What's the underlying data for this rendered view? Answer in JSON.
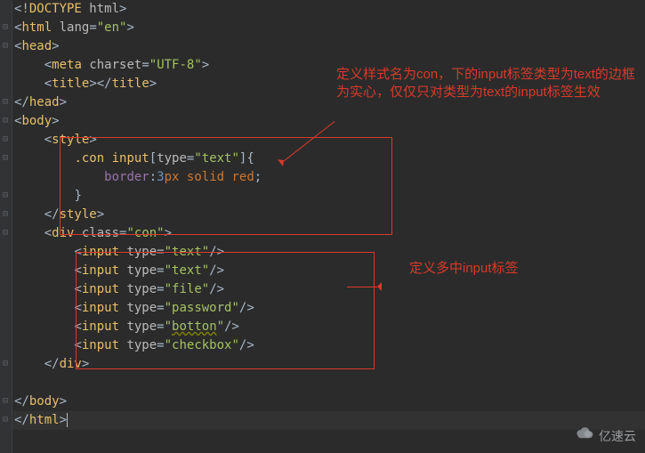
{
  "code": {
    "lines": [
      {
        "segments": [
          {
            "t": "<!",
            "c": "p"
          },
          {
            "t": "DOCTYPE ",
            "c": "tag"
          },
          {
            "t": "html",
            "c": "attr"
          },
          {
            "t": ">",
            "c": "p"
          }
        ]
      },
      {
        "segments": [
          {
            "t": "<",
            "c": "p"
          },
          {
            "t": "html ",
            "c": "tag"
          },
          {
            "t": "lang",
            "c": "attr"
          },
          {
            "t": "=",
            "c": "eq"
          },
          {
            "t": "\"en\"",
            "c": "str"
          },
          {
            "t": ">",
            "c": "p"
          }
        ]
      },
      {
        "segments": [
          {
            "t": "<",
            "c": "p"
          },
          {
            "t": "head",
            "c": "tag"
          },
          {
            "t": ">",
            "c": "p"
          }
        ]
      },
      {
        "indent": 1,
        "segments": [
          {
            "t": "<",
            "c": "p"
          },
          {
            "t": "meta ",
            "c": "tag"
          },
          {
            "t": "charset",
            "c": "attr"
          },
          {
            "t": "=",
            "c": "eq"
          },
          {
            "t": "\"UTF-8\"",
            "c": "str"
          },
          {
            "t": ">",
            "c": "p"
          }
        ]
      },
      {
        "indent": 1,
        "segments": [
          {
            "t": "<",
            "c": "p"
          },
          {
            "t": "title",
            "c": "tag"
          },
          {
            "t": "></",
            "c": "p"
          },
          {
            "t": "title",
            "c": "tag"
          },
          {
            "t": ">",
            "c": "p"
          }
        ]
      },
      {
        "segments": [
          {
            "t": "</",
            "c": "p"
          },
          {
            "t": "head",
            "c": "tag"
          },
          {
            "t": ">",
            "c": "p"
          }
        ]
      },
      {
        "segments": [
          {
            "t": "<",
            "c": "p"
          },
          {
            "t": "body",
            "c": "tag"
          },
          {
            "t": ">",
            "c": "p"
          }
        ]
      },
      {
        "indent": 1,
        "segments": [
          {
            "t": "<",
            "c": "p"
          },
          {
            "t": "style",
            "c": "tag"
          },
          {
            "t": ">",
            "c": "p"
          }
        ]
      },
      {
        "indent": 2,
        "segments": [
          {
            "t": ".con ",
            "c": "sel"
          },
          {
            "t": "input",
            "c": "tag"
          },
          {
            "t": "[",
            "c": "p"
          },
          {
            "t": "type",
            "c": "attr"
          },
          {
            "t": "=",
            "c": "eq"
          },
          {
            "t": "\"text\"",
            "c": "str"
          },
          {
            "t": "]{",
            "c": "p"
          }
        ]
      },
      {
        "indent": 3,
        "segments": [
          {
            "t": "border",
            "c": "id"
          },
          {
            "t": ":",
            "c": "p"
          },
          {
            "t": "3",
            "c": "num"
          },
          {
            "t": "px ",
            "c": "kw"
          },
          {
            "t": "solid ",
            "c": "kw"
          },
          {
            "t": "red",
            "c": "kw"
          },
          {
            "t": ";",
            "c": "p"
          }
        ]
      },
      {
        "indent": 2,
        "segments": [
          {
            "t": "}",
            "c": "p"
          }
        ]
      },
      {
        "indent": 1,
        "segments": [
          {
            "t": "</",
            "c": "p"
          },
          {
            "t": "style",
            "c": "tag"
          },
          {
            "t": ">",
            "c": "p"
          }
        ]
      },
      {
        "indent": 1,
        "segments": [
          {
            "t": "<",
            "c": "p"
          },
          {
            "t": "div ",
            "c": "tag"
          },
          {
            "t": "class",
            "c": "attr"
          },
          {
            "t": "=",
            "c": "eq"
          },
          {
            "t": "\"con\"",
            "c": "str"
          },
          {
            "t": ">",
            "c": "p"
          }
        ]
      },
      {
        "indent": 2,
        "segments": [
          {
            "t": "<",
            "c": "p"
          },
          {
            "t": "input ",
            "c": "tag"
          },
          {
            "t": "type",
            "c": "attr"
          },
          {
            "t": "=",
            "c": "eq"
          },
          {
            "t": "\"text\"",
            "c": "str"
          },
          {
            "t": "/>",
            "c": "p"
          }
        ]
      },
      {
        "indent": 2,
        "segments": [
          {
            "t": "<",
            "c": "p"
          },
          {
            "t": "input ",
            "c": "tag"
          },
          {
            "t": "type",
            "c": "attr"
          },
          {
            "t": "=",
            "c": "eq"
          },
          {
            "t": "\"text\"",
            "c": "str"
          },
          {
            "t": "/>",
            "c": "p"
          }
        ]
      },
      {
        "indent": 2,
        "segments": [
          {
            "t": "<",
            "c": "p"
          },
          {
            "t": "input ",
            "c": "tag"
          },
          {
            "t": "type",
            "c": "attr"
          },
          {
            "t": "=",
            "c": "eq"
          },
          {
            "t": "\"file\"",
            "c": "str"
          },
          {
            "t": "/>",
            "c": "p"
          }
        ]
      },
      {
        "indent": 2,
        "segments": [
          {
            "t": "<",
            "c": "p"
          },
          {
            "t": "input ",
            "c": "tag"
          },
          {
            "t": "type",
            "c": "attr"
          },
          {
            "t": "=",
            "c": "eq"
          },
          {
            "t": "\"password\"",
            "c": "str"
          },
          {
            "t": "/>",
            "c": "p"
          }
        ]
      },
      {
        "indent": 2,
        "segments": [
          {
            "t": "<",
            "c": "p"
          },
          {
            "t": "input ",
            "c": "tag"
          },
          {
            "t": "type",
            "c": "attr"
          },
          {
            "t": "=",
            "c": "eq"
          },
          {
            "t": "\"",
            "c": "str"
          },
          {
            "t": "botton",
            "c": "str warn"
          },
          {
            "t": "\"",
            "c": "str"
          },
          {
            "t": "/>",
            "c": "p"
          }
        ]
      },
      {
        "indent": 2,
        "segments": [
          {
            "t": "<",
            "c": "p"
          },
          {
            "t": "input ",
            "c": "tag"
          },
          {
            "t": "type",
            "c": "attr"
          },
          {
            "t": "=",
            "c": "eq"
          },
          {
            "t": "\"checkbox\"",
            "c": "str"
          },
          {
            "t": "/>",
            "c": "p"
          }
        ]
      },
      {
        "indent": 1,
        "segments": [
          {
            "t": "</",
            "c": "p"
          },
          {
            "t": "div",
            "c": "tag"
          },
          {
            "t": ">",
            "c": "p"
          }
        ]
      },
      {
        "segments": []
      },
      {
        "segments": [
          {
            "t": "</",
            "c": "p"
          },
          {
            "t": "body",
            "c": "tag"
          },
          {
            "t": ">",
            "c": "p"
          }
        ]
      },
      {
        "segments": [
          {
            "t": "</",
            "c": "p"
          },
          {
            "t": "html",
            "c": "tag"
          },
          {
            "t": ">",
            "c": "p"
          }
        ]
      }
    ],
    "folds": [
      {
        "line": 1,
        "glyph": "⊟"
      },
      {
        "line": 2,
        "glyph": "⊟"
      },
      {
        "line": 5,
        "glyph": "⊟"
      },
      {
        "line": 6,
        "glyph": "⊟"
      },
      {
        "line": 7,
        "glyph": "⊟"
      },
      {
        "line": 8,
        "glyph": "⊟"
      },
      {
        "line": 10,
        "glyph": "⊟"
      },
      {
        "line": 11,
        "glyph": "⊟"
      },
      {
        "line": 12,
        "glyph": "⊟"
      },
      {
        "line": 19,
        "glyph": "⊟"
      },
      {
        "line": 21,
        "glyph": "⊟"
      },
      {
        "line": 22,
        "glyph": "⊟"
      }
    ],
    "caret_line": 22
  },
  "annotations": {
    "top": "定义样式名为con，下的input标签类型为text的边框为实心，仅仅只对类型为text的input标签生效",
    "right": "定义多中input标签"
  },
  "watermark": "亿速云"
}
